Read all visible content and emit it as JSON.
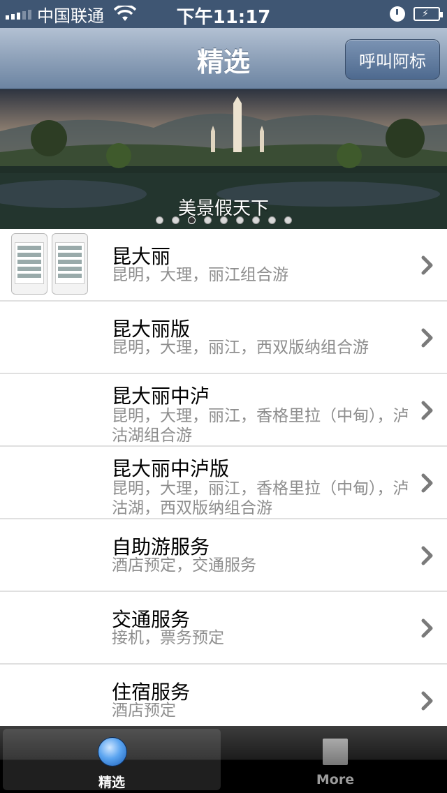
{
  "status_bar": {
    "carrier": "中国联通",
    "time": "下午11:17"
  },
  "nav": {
    "title": "精选",
    "right_button": "呼叫阿标"
  },
  "banner": {
    "caption": "美景假天下",
    "page_count": 9,
    "active_page": 3
  },
  "list": [
    {
      "title": "昆大丽",
      "subtitle": "昆明，大理，丽江组合游",
      "has_thumbnail": true
    },
    {
      "title": "昆大丽版",
      "subtitle": "昆明，大理，丽江，西双版纳组合游"
    },
    {
      "title": "昆大丽中泸",
      "subtitle": "昆明，大理，丽江，香格里拉（中甸），泸沽湖组合游"
    },
    {
      "title": "昆大丽中泸版",
      "subtitle": "昆明，大理，丽江，香格里拉（中甸），泸沽湖，西双版纳组合游"
    },
    {
      "title": "自助游服务",
      "subtitle": "酒店预定，交通服务"
    },
    {
      "title": "交通服务",
      "subtitle": "接机，票务预定"
    },
    {
      "title": "住宿服务",
      "subtitle": "酒店预定"
    }
  ],
  "tabs": [
    {
      "label": "精选",
      "icon": "globe-icon",
      "active": true
    },
    {
      "label": "More",
      "icon": "square-icon",
      "active": false
    }
  ]
}
